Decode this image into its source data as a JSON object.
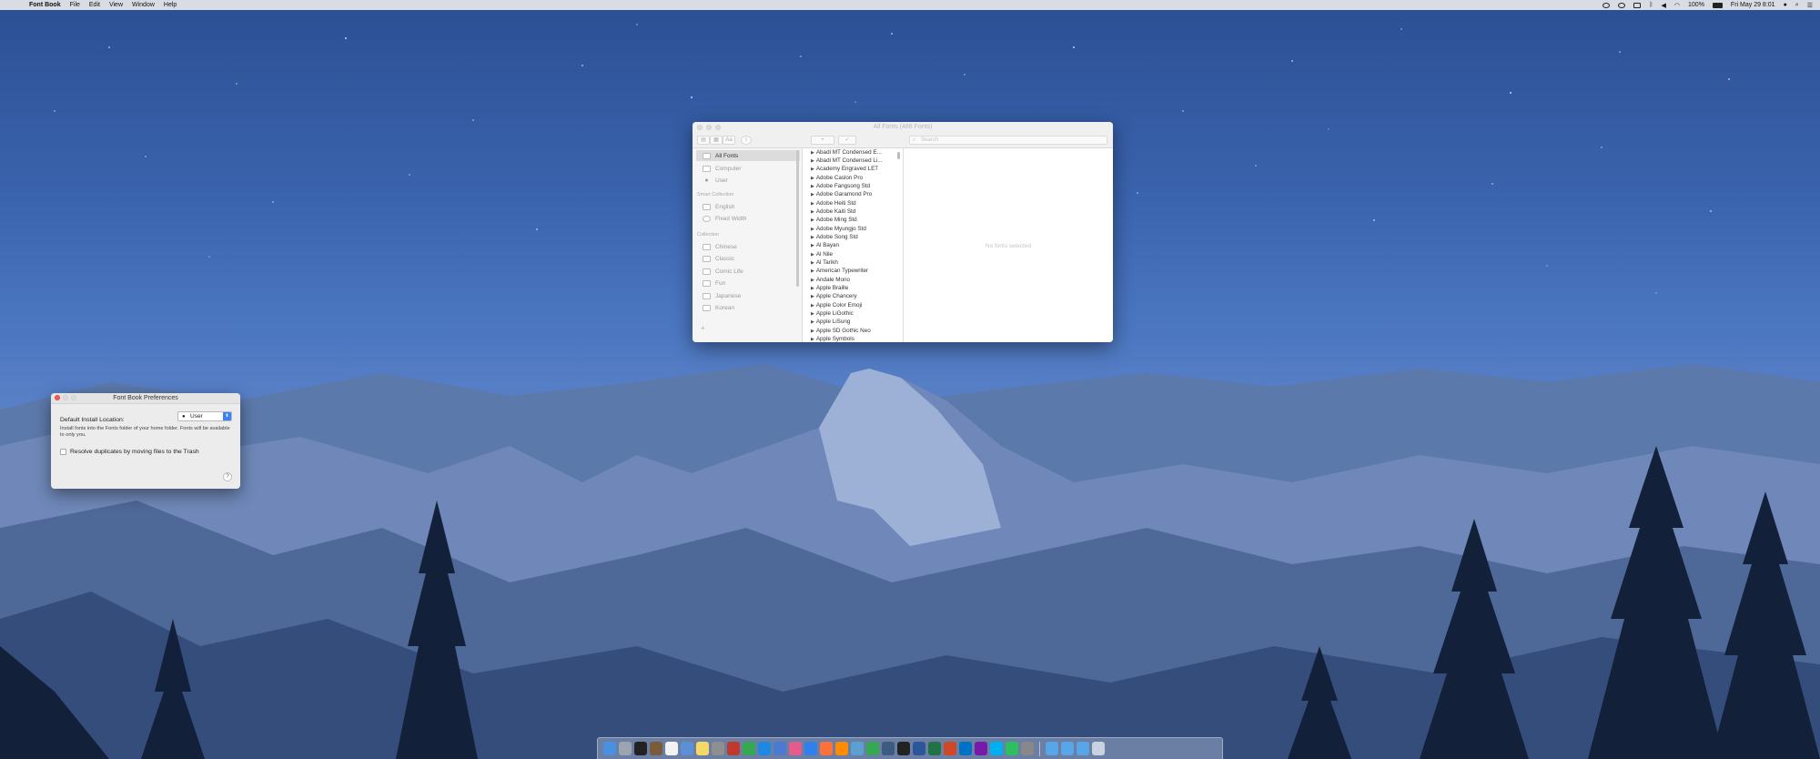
{
  "menubar": {
    "apple_icon": "apple-logo",
    "app_name": "Font Book",
    "menus": [
      "File",
      "Edit",
      "View",
      "Window",
      "Help"
    ],
    "battery": "100%",
    "clock": "Fri May 29  8:01"
  },
  "fontbook": {
    "title": "All Fonts (488 Fonts)",
    "toolbar": {
      "add_label": "+",
      "check_label": "✓",
      "search_placeholder": "Search",
      "preview_label": "Aa",
      "info_label": "i"
    },
    "sidebar": {
      "top_items": [
        "All Fonts",
        "Computer",
        "User"
      ],
      "smart_collection_heading": "Smart Collection",
      "smart_items": [
        "English",
        "Fixed Width"
      ],
      "collection_heading": "Collection",
      "collection_items": [
        "Chinese",
        "Classic",
        "Comic Life",
        "Fun",
        "Japanese",
        "Korean"
      ],
      "add_label": "+"
    },
    "fonts": [
      "Abadi MT Condensed E...",
      "Abadi MT Condensed Li...",
      "Academy Engraved LET",
      "Adobe Caslon Pro",
      "Adobe Fangsong Std",
      "Adobe Garamond Pro",
      "Adobe Heiti Std",
      "Adobe Kaiti Std",
      "Adobe Ming Std",
      "Adobe Myungjo Std",
      "Adobe Song Std",
      "Al Bayan",
      "Al Nile",
      "Al Tarikh",
      "American Typewriter",
      "Andale Mono",
      "Apple Braille",
      "Apple Chancery",
      "Apple Color Emoji",
      "Apple LiGothic",
      "Apple LiSung",
      "Apple SD Gothic Neo",
      "Apple Symbols"
    ],
    "no_selection": "No fonts selected"
  },
  "preferences": {
    "title": "Font Book Preferences",
    "install_location_label": "Default Install Location:",
    "install_location_value": "User",
    "description": "Install fonts into the Fonts folder of your home folder. Fonts will be available to only you.",
    "resolve_duplicates_label": "Resolve duplicates by moving files to the Trash",
    "help_label": "?"
  },
  "colors": {
    "sky_top": "#2c4f93",
    "sky_mid": "#5a82c8",
    "mountain": "#6e86b4",
    "trees": "#12203a",
    "close_red": "#f05b57",
    "select_blue": "#3b82f6"
  },
  "dock": {
    "icons": [
      "finder-icon",
      "launchpad-icon",
      "terminal-icon",
      "dictionary-icon",
      "textedit-icon",
      "preview-icon",
      "notes-icon",
      "calculator-icon",
      "photo-icon",
      "chrome-icon",
      "safari-icon",
      "mail-icon",
      "itunes-icon",
      "appstore-icon",
      "firefox-icon",
      "vlc-icon",
      "iphoto-icon",
      "chrome2-icon",
      "grapher-icon",
      "activity-icon",
      "word-icon",
      "excel-icon",
      "powerpoint-icon",
      "outlook-icon",
      "onenote-icon",
      "skype-icon",
      "evernote-icon",
      "fontbook-icon",
      "downloads-folder-icon",
      "documents-folder-icon",
      "applications-folder-icon",
      "trash-icon"
    ],
    "icon_colors": [
      "#4a90e2",
      "#9aa5b1",
      "#222222",
      "#7a5c3a",
      "#f2f2f2",
      "#5d8fd6",
      "#f6d965",
      "#8f8f8f",
      "#c0392b",
      "#34a853",
      "#1e88e5",
      "#4a7bd0",
      "#e55b8c",
      "#2f80ed",
      "#ff7139",
      "#ff8c00",
      "#5ba0d0",
      "#34a853",
      "#3d5a80",
      "#222222",
      "#2b579a",
      "#217346",
      "#d24726",
      "#0072c6",
      "#7719aa",
      "#00aff0",
      "#2dbe60",
      "#888888",
      "#58a6ea",
      "#58a6ea",
      "#58a6ea",
      "#c9d3e0"
    ]
  }
}
